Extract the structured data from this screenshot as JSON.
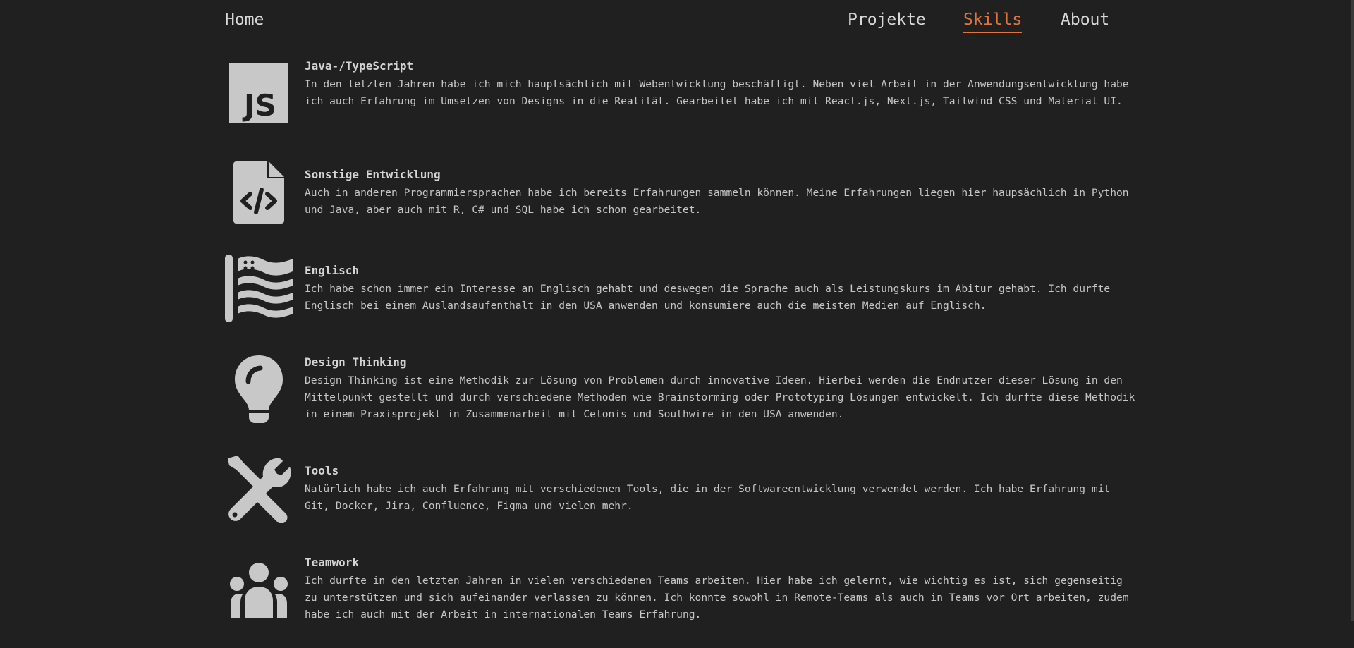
{
  "nav": {
    "home": "Home",
    "projekte": "Projekte",
    "skills": "Skills",
    "about": "About"
  },
  "colors": {
    "background": "#202020",
    "accent": "#e0743b",
    "icon": "#c8c8c8"
  },
  "skills": [
    {
      "icon": "javascript-icon",
      "title": "Java-/TypeScript",
      "text": "In den letzten Jahren habe ich mich hauptsächlich mit Webentwicklung beschäftigt. Neben viel Arbeit in der Anwendungsentwicklung habe ich auch Erfahrung im Umsetzen von Designs in die Realität. Gearbeitet habe ich mit React.js, Next.js, Tailwind CSS und Material UI."
    },
    {
      "icon": "code-file-icon",
      "title": "Sonstige Entwicklung",
      "text": "Auch in anderen Programmiersprachen habe ich bereits Erfahrungen sammeln können. Meine Erfahrungen liegen hier haupsächlich in Python und Java, aber auch mit R, C# und SQL habe ich schon gearbeitet."
    },
    {
      "icon": "flag-usa-icon",
      "title": "Englisch",
      "text": "Ich habe schon immer ein Interesse an Englisch gehabt und deswegen die Sprache auch als Leistungskurs im Abitur gehabt. Ich durfte Englisch bei einem Auslandsaufenthalt in den USA anwenden und konsumiere auch die meisten Medien auf Englisch."
    },
    {
      "icon": "lightbulb-icon",
      "title": "Design Thinking",
      "text": "Design Thinking ist eine Methodik zur Lösung von Problemen durch innovative Ideen. Hierbei werden die Endnutzer dieser Lösung in den Mittelpunkt gestellt und durch verschiedene Methoden wie Brainstorming oder Prototyping Lösungen entwickelt. Ich durfte diese Methodik in einem Praxisprojekt in Zusammenarbeit mit Celonis und Southwire in den USA anwenden."
    },
    {
      "icon": "tools-icon",
      "title": "Tools",
      "text": "Natürlich habe ich auch Erfahrung mit verschiedenen Tools, die in der Softwareentwicklung verwendet werden. Ich habe Erfahrung mit Git, Docker, Jira, Confluence, Figma und vielen mehr."
    },
    {
      "icon": "people-group-icon",
      "title": "Teamwork",
      "text": "Ich durfte in den letzten Jahren in vielen verschiedenen Teams arbeiten. Hier habe ich gelernt, wie wichtig es ist, sich gegenseitig zu unterstützen und sich aufeinander verlassen zu können. Ich konnte sowohl in Remote-Teams als auch in Teams vor Ort arbeiten, zudem habe ich auch mit der Arbeit in internationalen Teams Erfahrung."
    }
  ]
}
